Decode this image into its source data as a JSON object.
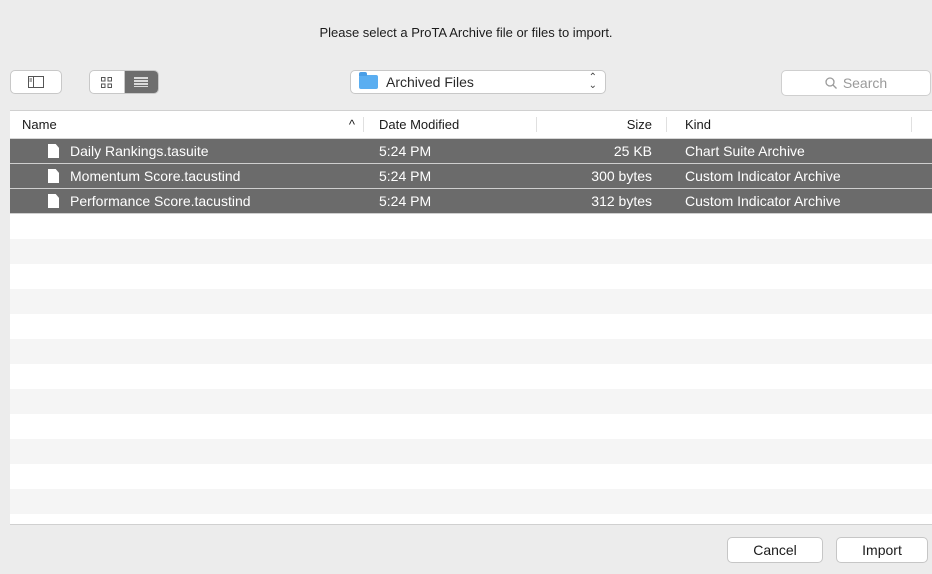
{
  "dialog": {
    "message": "Please select a ProTA Archive file or files to import."
  },
  "toolbar": {
    "sidebar_toggle_icon": "sidebar-icon",
    "view_modes": [
      "icon-view-icon",
      "list-view-icon"
    ],
    "active_view": "list",
    "location": "Archived Files",
    "search_placeholder": "Search"
  },
  "table": {
    "columns": {
      "name": "Name",
      "date": "Date Modified",
      "size": "Size",
      "kind": "Kind",
      "sort_indicator": "^"
    },
    "rows": [
      {
        "name": "Daily Rankings.tasuite",
        "date": "5:24 PM",
        "size": "25 KB",
        "kind": "Chart Suite Archive"
      },
      {
        "name": "Momentum Score.tacustind",
        "date": "5:24 PM",
        "size": "300 bytes",
        "kind": "Custom Indicator Archive"
      },
      {
        "name": "Performance Score.tacustind",
        "date": "5:24 PM",
        "size": "312 bytes",
        "kind": "Custom Indicator Archive"
      }
    ]
  },
  "footer": {
    "cancel_label": "Cancel",
    "import_label": "Import"
  },
  "colors": {
    "selection": "#6b6b6b",
    "folder": "#5aaef1",
    "stripe": "#f5f5f5"
  }
}
